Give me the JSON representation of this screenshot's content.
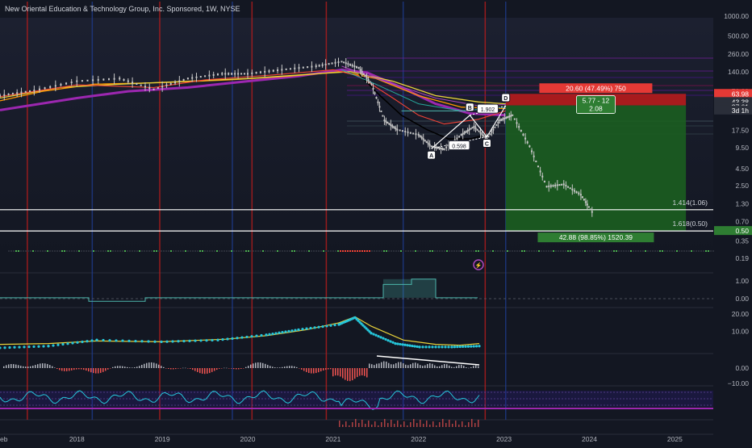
{
  "header": {
    "title": "New Oriental Education & Technology Group, Inc. Sponsored, 1W, NYSE"
  },
  "colors": {
    "background": "#131722",
    "candle": "#c8c8c8",
    "ma_orange": "#ff9800",
    "ma_yellow": "#e8d23a",
    "ma_purple": "#9c27b0",
    "ma_black": "#000000",
    "ma_red": "#f44336",
    "ma_teal": "#4db6ac",
    "vline_red": "#b71c1c",
    "vline_blue": "#1e3a8a",
    "zone_red": "#b71c1c",
    "zone_green": "#1b5e20",
    "label_red": "#e53935",
    "label_green": "#2e7d32",
    "cyan": "#26c6da",
    "hist_up": "#b2b5be",
    "hist_down": "#ef5350"
  },
  "chart_data": {
    "type": "line",
    "title": "New Oriental Education & Technology Group, Inc. Sponsored, 1W, NYSE",
    "y_scale": "log",
    "x_ticks": [
      "eb",
      "2018",
      "2019",
      "2020",
      "2021",
      "2022",
      "2023",
      "2024",
      "2025"
    ],
    "y_ticks": [
      "1000.00",
      "500.00",
      "260.00",
      "140.00",
      "70.00",
      "17.50",
      "9.50",
      "4.50",
      "2.50",
      "1.30",
      "0.70",
      "0.35",
      "0.19"
    ],
    "price_labels": [
      {
        "text": "63.98",
        "color": "red"
      },
      {
        "text": "43.38",
        "color": "dark"
      },
      {
        "text": "37.61",
        "color": "dark"
      },
      {
        "text": "3d 1h",
        "color": "dark"
      },
      {
        "text": "0.50",
        "color": "green"
      }
    ],
    "price_series": {
      "name": "",
      "x": [
        2017.1,
        2017.5,
        2018.0,
        2018.5,
        2018.9,
        2019.3,
        2019.7,
        2020.0,
        2020.4,
        2020.8,
        2021.1,
        2021.3,
        2021.45,
        2021.6,
        2021.75,
        2022.0,
        2022.15,
        2022.3,
        2022.5,
        2022.65,
        2022.8,
        2022.95,
        2023.1,
        2023.3,
        2023.5,
        2023.7,
        2023.9,
        2024.05
      ],
      "y": [
        60,
        72,
        100,
        110,
        75,
        110,
        130,
        130,
        150,
        170,
        200,
        160,
        90,
        25,
        18,
        15,
        10,
        9,
        15,
        20,
        13,
        25,
        30,
        10,
        2.4,
        2.6,
        1.8,
        0.9
      ]
    },
    "fib_levels": [
      {
        "label": "1.414(1.06)",
        "value": 1.06
      },
      {
        "label": "1.618(0.50)",
        "value": 0.5
      }
    ],
    "harmonic_points": [
      {
        "label": "A",
        "x": 2022.15,
        "y": 9.2
      },
      {
        "label": "B",
        "x": 2022.6,
        "y": 30
      },
      {
        "label": "C",
        "x": 2022.8,
        "y": 14
      },
      {
        "label": "D",
        "x": 2023.02,
        "y": 42
      }
    ],
    "harmonic_ratios": [
      "0.598",
      "1.902"
    ],
    "position": {
      "entry": 42.5,
      "stop": 63.98,
      "target": 0.5,
      "risk_label": "20.60 (47.49%) 750",
      "ratio_label_1": "5.77 - 12",
      "ratio_label_2": "2.08",
      "reward_label": "42.88 (98.85%) 1520.39"
    },
    "indicator_panes": [
      {
        "name": "",
        "y_ticks": [
          "1.00",
          "0.00"
        ]
      },
      {
        "name": "",
        "y_ticks": [
          "20.00",
          "10.00"
        ]
      },
      {
        "name": "",
        "y_ticks": [
          "0.00",
          "−10.00"
        ]
      },
      {
        "name": "",
        "y_ticks": []
      },
      {
        "name": "",
        "y_ticks": []
      }
    ]
  }
}
